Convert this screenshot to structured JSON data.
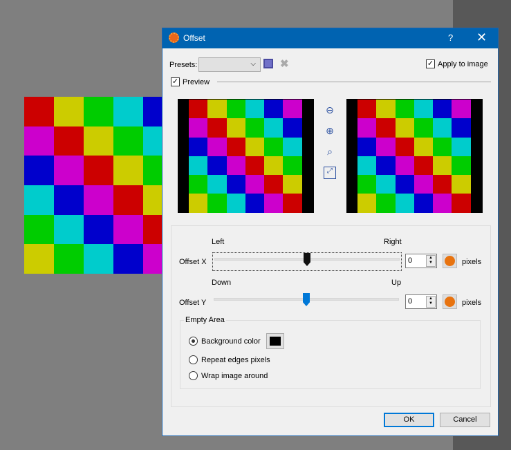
{
  "palette": [
    "#cc0000",
    "#cccc00",
    "#00cc00",
    "#00cccc",
    "#0000cc",
    "#cc00cc"
  ],
  "dialog": {
    "title": "Offset",
    "help": "?",
    "close": "✕"
  },
  "presets": {
    "label": "Presets:",
    "value": "",
    "apply_label": "Apply to image",
    "apply_checked": true
  },
  "preview": {
    "label": "Preview",
    "checked": true
  },
  "offset_x": {
    "label": "Offset X",
    "min_label": "Left",
    "max_label": "Right",
    "value": "0",
    "unit": "pixels",
    "slider_fraction": 0.5
  },
  "offset_y": {
    "label": "Offset Y",
    "min_label": "Down",
    "max_label": "Up",
    "value": "0",
    "unit": "pixels",
    "slider_fraction": 0.5
  },
  "empty_area": {
    "title": "Empty Area",
    "options": [
      "Background color",
      "Repeat edges pixels",
      "Wrap image around"
    ],
    "selected": 0,
    "background_color": "#000000"
  },
  "buttons": {
    "ok": "OK",
    "cancel": "Cancel"
  }
}
